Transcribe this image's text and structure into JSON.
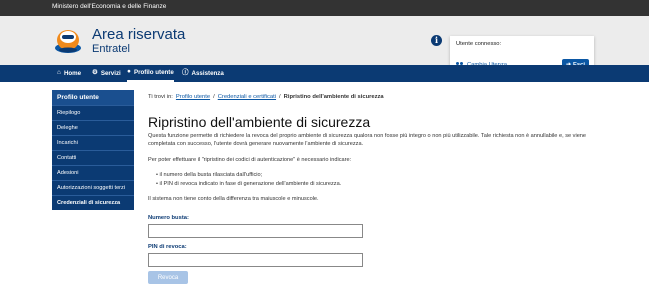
{
  "topbar": {
    "ministry": "Ministero dell'Economia e delle Finanze"
  },
  "header": {
    "title": "Area riservata",
    "subtitle": "Entratel",
    "info_icon": "info-icon"
  },
  "userbox": {
    "label": "Utente connesso:",
    "change_user": "Cambia Utenza",
    "logout": "Esci"
  },
  "nav": [
    {
      "label": "Home",
      "icon": "home-icon"
    },
    {
      "label": "Servizi",
      "icon": "gear-icon"
    },
    {
      "label": "Profilo utente",
      "icon": "user-icon"
    },
    {
      "label": "Assistenza",
      "icon": "info-icon"
    }
  ],
  "sidebar": {
    "heading": "Profilo utente",
    "items": [
      {
        "label": "Riepilogo"
      },
      {
        "label": "Deleghe"
      },
      {
        "label": "Incarichi"
      },
      {
        "label": "Contatti"
      },
      {
        "label": "Adesioni"
      },
      {
        "label": "Autorizzazioni soggetti terzi"
      },
      {
        "label": "Credenziali di sicurezza"
      }
    ]
  },
  "breadcrumb": {
    "prefix": "Ti trovi in:",
    "link1": "Profilo utente",
    "link2": "Credenziali e certificati",
    "current": "Ripristino dell'ambiente di sicurezza",
    "sep": "/"
  },
  "page": {
    "title": "Ripristino dell'ambiente di sicurezza",
    "para1": "Questa funzione permette di richiedere la revoca del proprio ambiente di sicurezza qualora non fosse più integro o non più utilizzabile. Tale richiesta non è annullabile e, se viene completata con successo, l'utente dovrà generare nuovamente l'ambiente di sicurezza.",
    "para2": "Per poter effettuare il \"ripristino dei codici di autenticazione\" è necessario indicare:",
    "bullet1": "il numero della busta rilasciata dall'ufficio;",
    "bullet2": "il PIN di revoca indicato in fase di generazione dell'ambiente di sicurezza.",
    "para3": "Il sistema non tiene conto della differenza tra maiuscole e minuscole."
  },
  "form": {
    "busta_label": "Numero busta:",
    "busta_value": "",
    "pin_label": "PIN di revoca:",
    "pin_value": "",
    "submit": "Revoca"
  },
  "colors": {
    "primary": "#0b3a73",
    "accent": "#0b57a4",
    "button_disabled": "#a8c4e6",
    "topbar": "#333333",
    "header_bg": "#ececec"
  }
}
